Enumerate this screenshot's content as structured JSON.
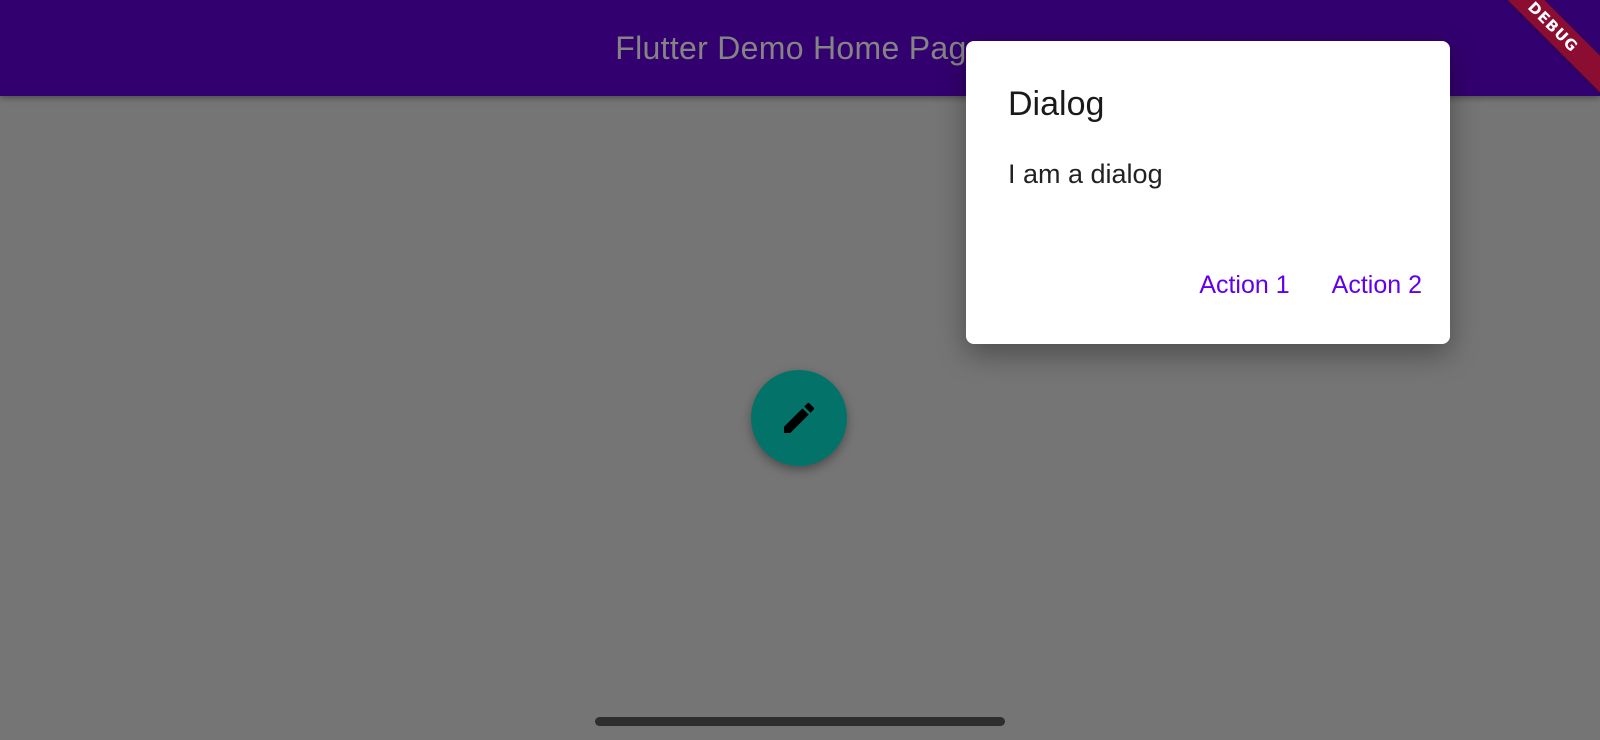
{
  "appbar": {
    "title": "Flutter Demo Home Page"
  },
  "debug_banner": {
    "label": "DEBUG"
  },
  "dialog": {
    "title": "Dialog",
    "content": "I am a dialog",
    "actions": [
      {
        "label": "Action 1"
      },
      {
        "label": "Action 2"
      }
    ]
  },
  "fab": {
    "icon": "pencil-icon"
  },
  "colors": {
    "appbar": "#33006f",
    "scrim": "#757575",
    "fab": "#03736a",
    "action_text": "#6200ee",
    "debug_banner": "#8b0d31"
  }
}
